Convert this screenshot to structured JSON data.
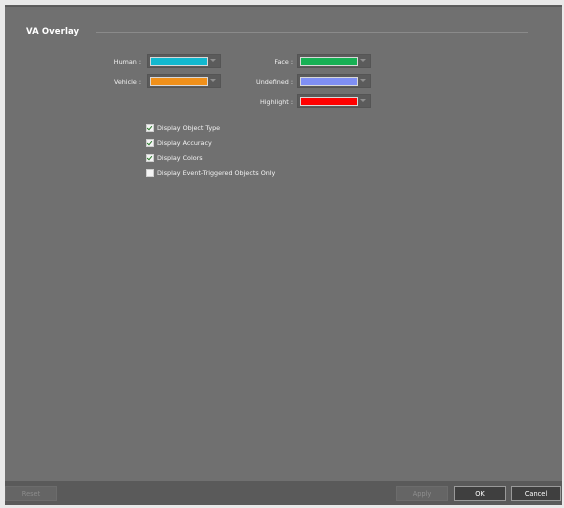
{
  "section": {
    "title": "VA Overlay"
  },
  "colors": {
    "human": {
      "label": "Human :",
      "color": "#12b8cf"
    },
    "vehicle": {
      "label": "Vehicle :",
      "color": "#f0901a"
    },
    "face": {
      "label": "Face :",
      "color": "#17b054"
    },
    "undefined": {
      "label": "Undefined :",
      "color": "#7f8ff5"
    },
    "highlight": {
      "label": "Highlight :",
      "color": "#ff0000"
    }
  },
  "options": [
    {
      "label": "Display Object Type",
      "checked": true
    },
    {
      "label": "Display Accuracy",
      "checked": true
    },
    {
      "label": "Display Colors",
      "checked": true
    },
    {
      "label": "Display Event-Triggered Objects Only",
      "checked": false
    }
  ],
  "footer": {
    "reset": "Reset",
    "apply": "Apply",
    "ok": "OK",
    "cancel": "Cancel"
  }
}
